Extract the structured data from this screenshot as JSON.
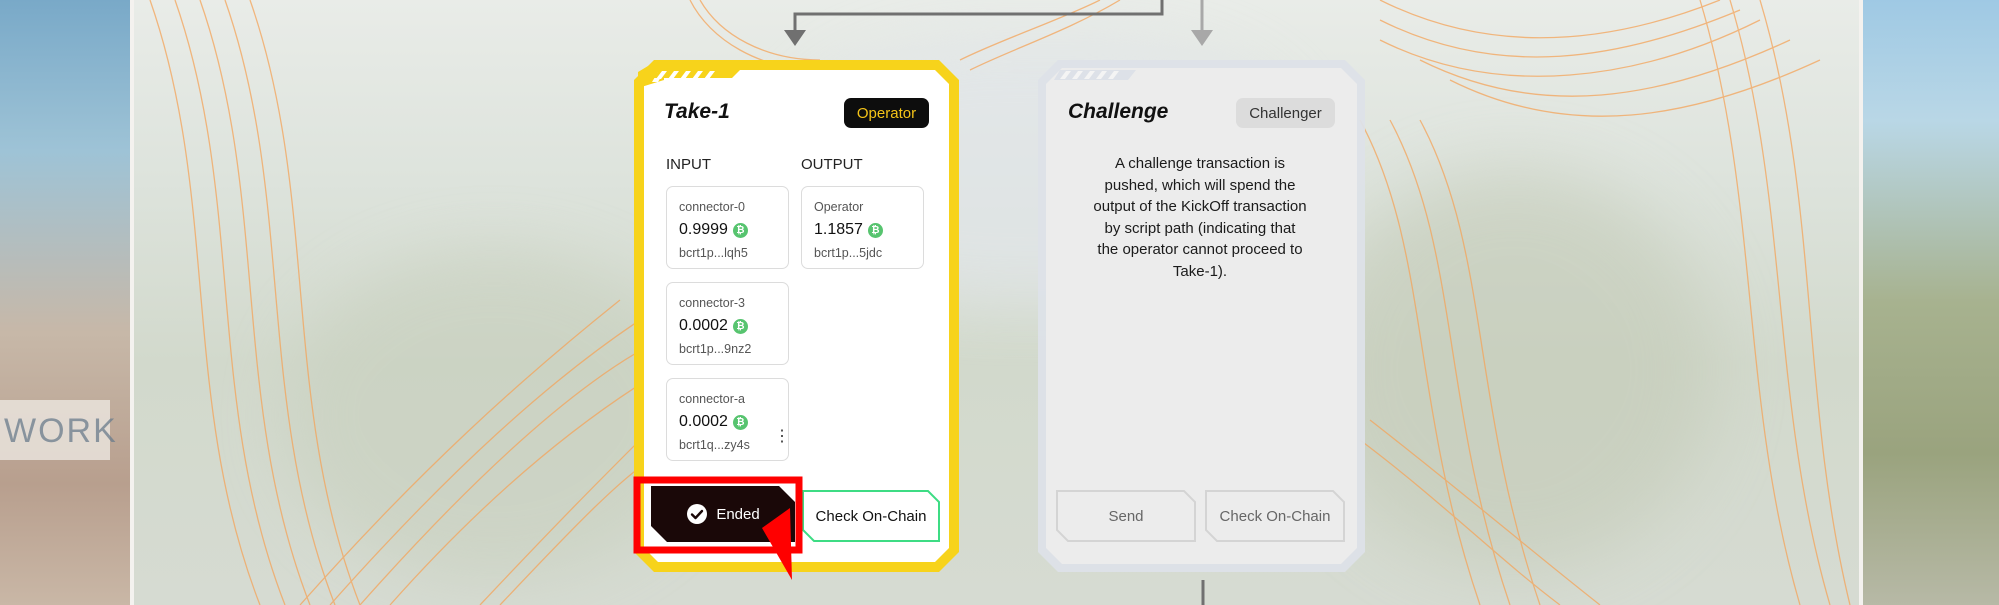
{
  "cards": {
    "take1": {
      "title": "Take-1",
      "role": "Operator",
      "input_header": "INPUT",
      "output_header": "OUTPUT",
      "inputs": [
        {
          "name": "connector-0",
          "amount": "0.9999",
          "address": "bcrt1p...lqh5"
        },
        {
          "name": "connector-3",
          "amount": "0.0002",
          "address": "bcrt1p...9nz2"
        },
        {
          "name": "connector-a",
          "amount": "0.0002",
          "address": "bcrt1q...zy4s"
        }
      ],
      "outputs": [
        {
          "name": "Operator",
          "amount": "1.1857",
          "address": "bcrt1p...5jdc"
        }
      ],
      "status_button": "Ended",
      "check_button": "Check On-Chain"
    },
    "challenge": {
      "title": "Challenge",
      "role": "Challenger",
      "description_lines": [
        "A challenge transaction is",
        "pushed, which will spend the",
        "output of the KickOff transaction",
        "by script path (indicating that",
        "the operator cannot proceed to",
        "Take-1)."
      ],
      "send_button": "Send",
      "check_button": "Check On-Chain"
    }
  },
  "background_sign_text": "WORK",
  "colors": {
    "operator_accent": "#f7d31b",
    "chain_button_border": "#3ddc84",
    "highlight_box": "#ff0000",
    "btc_icon": "#57c46f",
    "ended_button_bg": "#1a0808"
  },
  "icons": {
    "btc": "bitcoin-icon",
    "ended": "check-circle-icon",
    "menu": "kebab-menu-icon"
  }
}
